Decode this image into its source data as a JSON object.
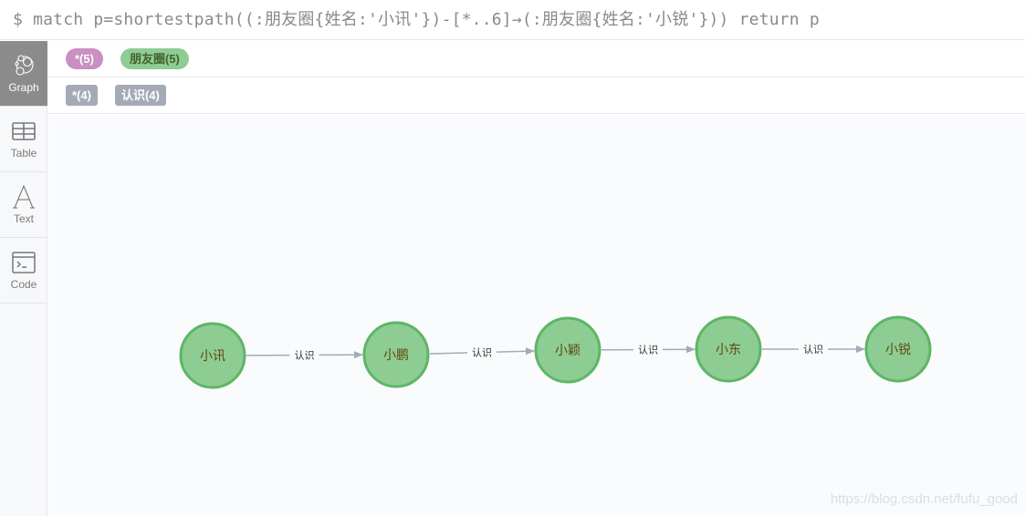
{
  "query": {
    "prompt": "$",
    "text": "match p=shortestpath((:朋友圈{姓名:'小讯'})-[*..6]→(:朋友圈{姓名:'小锐'})) return p"
  },
  "sidebar": {
    "items": [
      {
        "label": "Graph",
        "icon": "graph-icon",
        "active": true
      },
      {
        "label": "Table",
        "icon": "table-icon",
        "active": false
      },
      {
        "label": "Text",
        "icon": "text-icon",
        "active": false
      },
      {
        "label": "Code",
        "icon": "code-icon",
        "active": false
      }
    ]
  },
  "legend": {
    "node_labels": [
      {
        "label": "*(5)",
        "color": "#c990c0"
      },
      {
        "label": "朋友圈(5)",
        "color": "#8dcc93"
      }
    ],
    "relationship_types": [
      {
        "label": "*(4)",
        "color": "#a5abb6"
      },
      {
        "label": "认识(4)",
        "color": "#a5abb6"
      }
    ]
  },
  "graph": {
    "node_fill": "#8dcc93",
    "node_stroke": "#5db665",
    "node_text_color": "#604a0e",
    "edge_color": "#a5abb6",
    "nodes": [
      {
        "id": "n1",
        "name": "小讯"
      },
      {
        "id": "n2",
        "name": "小鹏"
      },
      {
        "id": "n3",
        "name": "小颖"
      },
      {
        "id": "n4",
        "name": "小东"
      },
      {
        "id": "n5",
        "name": "小锐"
      }
    ],
    "edges": [
      {
        "from": "n1",
        "to": "n2",
        "type": "认识"
      },
      {
        "from": "n2",
        "to": "n3",
        "type": "认识"
      },
      {
        "from": "n3",
        "to": "n4",
        "type": "认识"
      },
      {
        "from": "n4",
        "to": "n5",
        "type": "认识"
      }
    ]
  },
  "watermark": "https://blog.csdn.net/fufu_good"
}
